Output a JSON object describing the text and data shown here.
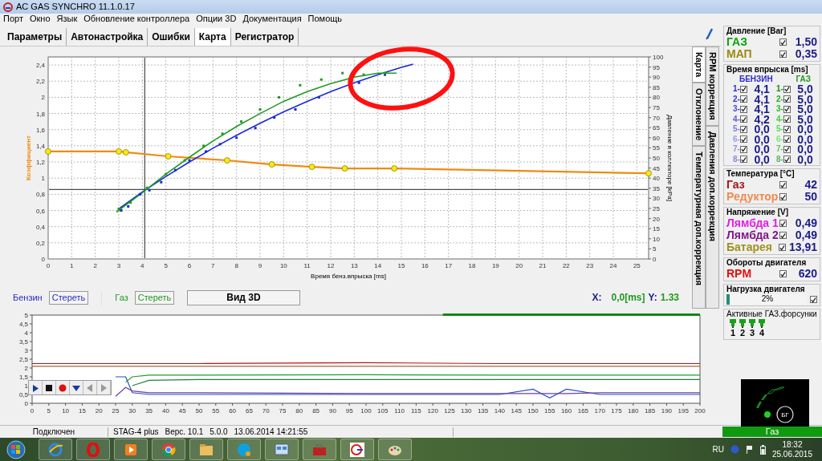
{
  "window": {
    "title": "AC GAS SYNCHRO  11.1.0.17"
  },
  "menu": [
    "Порт",
    "Окно",
    "Язык",
    "Обновление контроллера",
    "Опции 3D",
    "Документация",
    "Помощь"
  ],
  "tabs": [
    {
      "label": "Параметры",
      "selected": false
    },
    {
      "label": "Автонастройка",
      "selected": false
    },
    {
      "label": "Ошибки",
      "selected": false
    },
    {
      "label": "Карта",
      "selected": true
    },
    {
      "label": "Регистратор",
      "selected": false
    }
  ],
  "map_chart": {
    "chart_data": {
      "type": "line",
      "xlabel": "Время бенз.впрыска [ms]",
      "ylabel": "Коэффициент",
      "y2label": "Давление в коллекторе [kPa]",
      "xlim": [
        0,
        25.5
      ],
      "ylim": [
        0,
        2.5
      ],
      "y2lim": [
        0,
        100
      ],
      "xticks": [
        0,
        1,
        2,
        3,
        4,
        5,
        6,
        7,
        8,
        9,
        10,
        11,
        12,
        13,
        14,
        15,
        16,
        17,
        18,
        19,
        20,
        21,
        22,
        23,
        24,
        25
      ],
      "yticks": [
        0,
        {
          "value": 0.2,
          "label": "0,2"
        },
        {
          "value": 0.4,
          "label": "0,4"
        },
        {
          "value": 0.6,
          "label": "0,6"
        },
        {
          "value": 0.8,
          "label": "0,8"
        },
        1,
        {
          "value": 1.2,
          "label": "1,2"
        },
        {
          "value": 1.4,
          "label": "1,4"
        },
        {
          "value": 1.6,
          "label": "1,6"
        },
        {
          "value": 1.8,
          "label": "1,8"
        },
        2,
        {
          "value": 2.2,
          "label": "2,2"
        },
        {
          "value": 2.4,
          "label": "2,4"
        }
      ],
      "y2ticks": [
        0,
        5,
        10,
        15,
        20,
        25,
        30,
        35,
        40,
        45,
        50,
        55,
        60,
        65,
        70,
        75,
        80,
        85,
        90,
        95,
        100
      ],
      "series": [
        {
          "type": "line",
          "color": "#f08a10",
          "x": [
            0,
            3,
            3.3,
            5.1,
            7.6,
            9.5,
            11.2,
            12.6,
            14.7,
            25.5
          ],
          "values": [
            1.33,
            1.33,
            1.32,
            1.27,
            1.22,
            1.17,
            1.14,
            1.12,
            1.12,
            1.06
          ]
        },
        {
          "type": "scatter",
          "color": "#f5ec10",
          "x": [
            0,
            3,
            3.3,
            5.1,
            7.6,
            9.5,
            11.2,
            12.6,
            14.7,
            25.5
          ],
          "values": [
            1.33,
            1.33,
            1.32,
            1.27,
            1.22,
            1.17,
            1.14,
            1.12,
            1.12,
            1.06
          ]
        },
        {
          "type": "line",
          "color": "#1a2ad8",
          "x": [
            3,
            4,
            5,
            6,
            7,
            8,
            9,
            10,
            11,
            12,
            13,
            14,
            15,
            15.5
          ],
          "values": [
            0.62,
            0.83,
            1.02,
            1.2,
            1.37,
            1.53,
            1.68,
            1.82,
            1.95,
            2.07,
            2.18,
            2.28,
            2.37,
            2.41
          ]
        },
        {
          "type": "line",
          "color": "#1f9a1f",
          "x": [
            2.9,
            4,
            5,
            6,
            7,
            8,
            9,
            10,
            11,
            12,
            13,
            14,
            14.8
          ],
          "values": [
            0.58,
            0.82,
            1.05,
            1.26,
            1.46,
            1.64,
            1.8,
            1.95,
            2.07,
            2.17,
            2.25,
            2.3,
            2.3
          ]
        },
        {
          "type": "scatter",
          "color": "#1a2ad8",
          "x": [
            3.1,
            3.4,
            3.9,
            4.3,
            4.8,
            5.4,
            6.0,
            6.7,
            7.3,
            8.0,
            8.8,
            9.6,
            10.5,
            11.5,
            13.2,
            14.3
          ],
          "values": [
            0.6,
            0.65,
            0.8,
            0.85,
            0.95,
            1.1,
            1.22,
            1.33,
            1.42,
            1.5,
            1.62,
            1.75,
            1.85,
            2.0,
            2.18,
            2.28
          ]
        },
        {
          "type": "scatter",
          "color": "#1f9a1f",
          "x": [
            3.0,
            3.5,
            4.2,
            5.0,
            5.8,
            6.6,
            7.4,
            8.2,
            9.0,
            9.8,
            10.7,
            11.6,
            12.5,
            13.4,
            14.3
          ],
          "values": [
            0.62,
            0.7,
            0.88,
            1.05,
            1.22,
            1.4,
            1.55,
            1.7,
            1.85,
            2.0,
            2.15,
            2.22,
            2.3,
            2.28,
            2.3
          ]
        }
      ],
      "grid": true,
      "ref_lines": [
        {
          "axis": "x",
          "value": 4.1
        },
        {
          "axis": "y",
          "value": 0.86
        }
      ]
    }
  },
  "side_tabs_inner": [
    {
      "label": "Карта",
      "selected": true
    },
    {
      "label": "Отклонение",
      "selected": false
    },
    {
      "label": "Температурная доп.коррекция",
      "selected": false
    }
  ],
  "side_tabs_outer": [
    {
      "label": "RPM коррекция",
      "selected": false
    },
    {
      "label": "Давления доп.коррекция",
      "selected": false
    }
  ],
  "map_controls": {
    "petrol_label": "Бензин",
    "petrol_clear": "Стереть",
    "gas_label": "Газ",
    "gas_clear": "Стереть",
    "view3d": "Вид 3D",
    "x_label": "X:",
    "x_value": "0,0[ms]",
    "y_label": "Y:",
    "y_value": "1.33"
  },
  "recorder_chart": {
    "chart_data": {
      "type": "line",
      "xlim": [
        0,
        200
      ],
      "ylim": [
        0,
        5
      ],
      "xticks": [
        0,
        5,
        10,
        15,
        20,
        25,
        30,
        35,
        40,
        45,
        50,
        55,
        60,
        65,
        70,
        75,
        80,
        85,
        90,
        95,
        100,
        105,
        110,
        115,
        120,
        125,
        130,
        135,
        140,
        145,
        150,
        155,
        160,
        165,
        170,
        175,
        180,
        185,
        190,
        195,
        200
      ],
      "yticks": [
        0,
        {
          "value": 0.5,
          "label": "0,5"
        },
        1,
        {
          "value": 1.5,
          "label": "1,5"
        },
        2,
        {
          "value": 2.5,
          "label": "2,5"
        },
        3,
        {
          "value": 3.5,
          "label": "3,5"
        },
        4,
        {
          "value": 4.5,
          "label": "4,5"
        },
        5
      ],
      "x": [
        0,
        20,
        25,
        28,
        30,
        35,
        50,
        100,
        140,
        150,
        155,
        160,
        170,
        200
      ],
      "series": [
        {
          "color": "#c01010",
          "values": [
            2.25,
            2.25,
            2.25,
            2.25,
            2.25,
            2.25,
            2.25,
            2.3,
            2.25,
            2.25,
            2.25,
            2.25,
            2.25,
            2.25
          ]
        },
        {
          "color": "#b06030",
          "values": [
            2.1,
            2.1,
            2.1,
            2.1,
            2.1,
            2.1,
            2.1,
            2.1,
            2.1,
            2.1,
            2.1,
            2.1,
            2.1,
            2.1
          ]
        },
        {
          "color": "#20a020",
          "values": [
            null,
            null,
            null,
            1.2,
            1.5,
            1.6,
            1.6,
            1.62,
            1.6,
            1.6,
            1.6,
            1.6,
            1.6,
            1.6
          ]
        },
        {
          "color": "#208040",
          "values": [
            null,
            null,
            null,
            null,
            1.0,
            1.3,
            1.35,
            1.35,
            1.35,
            1.35,
            1.35,
            1.35,
            1.35,
            1.35
          ]
        },
        {
          "color": "#2050c0",
          "values": [
            null,
            null,
            1.5,
            1.5,
            0.6,
            0.5,
            0.5,
            0.5,
            0.5,
            0.8,
            0.3,
            0.8,
            0.5,
            0.5
          ]
        },
        {
          "color": "#7040a0",
          "values": [
            null,
            null,
            0.4,
            0.9,
            0.7,
            0.6,
            0.6,
            0.55,
            0.55,
            0.55,
            0.55,
            0.55,
            0.6,
            0.6
          ]
        }
      ]
    }
  },
  "panel": {
    "pressure": {
      "title": "Давление [Bar]",
      "rows": [
        {
          "label": "ГАЗ",
          "color": "#12a012",
          "checked": true,
          "value": "1,50"
        },
        {
          "label": "МАП",
          "color": "#9a8a10",
          "checked": true,
          "value": "0,35"
        }
      ]
    },
    "injection": {
      "title": "Время впрыска [ms]",
      "petrol_header": "БЕНЗИН",
      "gas_header": "ГАЗ",
      "rows": [
        {
          "petrol": {
            "label": "1-",
            "color": "#2a2ac8",
            "checked": true,
            "value": "4,1"
          },
          "gas": {
            "label": "1-",
            "color": "#109010",
            "checked": true,
            "value": "5,0"
          }
        },
        {
          "petrol": {
            "label": "2-",
            "color": "#3434cc",
            "checked": true,
            "value": "4,1"
          },
          "gas": {
            "label": "2-",
            "color": "#18b018",
            "checked": true,
            "value": "5,0"
          }
        },
        {
          "petrol": {
            "label": "3-",
            "color": "#4848d0",
            "checked": true,
            "value": "4,1"
          },
          "gas": {
            "label": "3-",
            "color": "#20c020",
            "checked": true,
            "value": "5,0"
          }
        },
        {
          "petrol": {
            "label": "4-",
            "color": "#5a5ad8",
            "checked": true,
            "value": "4,2"
          },
          "gas": {
            "label": "4-",
            "color": "#30d830",
            "checked": true,
            "value": "5,0"
          }
        },
        {
          "petrol": {
            "label": "5-",
            "color": "#7a7ae0",
            "checked": true,
            "value": "0,0"
          },
          "gas": {
            "label": "5-",
            "color": "#50e050",
            "checked": true,
            "value": "0,0"
          }
        },
        {
          "petrol": {
            "label": "6-",
            "color": "#9a9ae8",
            "checked": true,
            "value": "0,0"
          },
          "gas": {
            "label": "6-",
            "color": "#78e878",
            "checked": true,
            "value": "0,0"
          }
        },
        {
          "petrol": {
            "label": "7-",
            "color": "#9090e0",
            "checked": true,
            "value": "0,0"
          },
          "gas": {
            "label": "7-",
            "color": "#60c060",
            "checked": true,
            "value": "0,0"
          }
        },
        {
          "petrol": {
            "label": "8-",
            "color": "#8888d8",
            "checked": true,
            "value": "0,0"
          },
          "gas": {
            "label": "8-",
            "color": "#58b858",
            "checked": true,
            "value": "0,0"
          }
        }
      ]
    },
    "temperature": {
      "title": "Температура  [°C]",
      "rows": [
        {
          "label": "Газ",
          "color": "#a01818",
          "checked": true,
          "value": "42"
        },
        {
          "label": "Редуктор",
          "color": "#f08a50",
          "checked": true,
          "value": "50"
        }
      ]
    },
    "voltage": {
      "title": "Напряжение [V]",
      "rows": [
        {
          "label": "Лямбда 1",
          "color": "#e020e0",
          "checked": true,
          "value": "0,49"
        },
        {
          "label": "Лямбда 2",
          "color": "#80188a",
          "checked": true,
          "value": "0,49"
        },
        {
          "label": "Батарея",
          "color": "#a09020",
          "checked": true,
          "value": "13,91"
        }
      ]
    },
    "rpm": {
      "title": "Обороты двигателя",
      "rows": [
        {
          "label": "RPM",
          "color": "#e01010",
          "checked": true,
          "value": "620"
        }
      ]
    },
    "load": {
      "title": "Нагрузка двигателя",
      "value": "2%",
      "level": 0.02,
      "checked": true
    },
    "injectors": {
      "title": "Активные ГАЗ.форсунки",
      "items": [
        {
          "label": "1",
          "active": true
        },
        {
          "label": "2",
          "active": true
        },
        {
          "label": "3",
          "active": true
        },
        {
          "label": "4",
          "active": true
        }
      ]
    }
  },
  "switch": {
    "label": "БГ"
  },
  "status_bar": {
    "connection": "Подключен",
    "device": "STAG-4 plus",
    "version": "Верс. 10.1",
    "firmware": "5.0.0",
    "date": "13.06.2014 14:21:55",
    "fuel": "Газ"
  },
  "taskbar": {
    "language": "RU",
    "time": "18:32",
    "date": "25.06.2015"
  }
}
